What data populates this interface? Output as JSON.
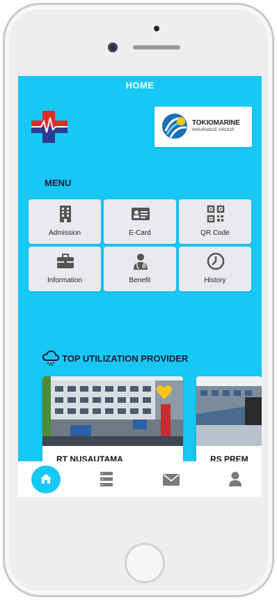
{
  "header": {
    "title": "HOME"
  },
  "partner": {
    "name": "TOKIOMARINE",
    "subtitle": "INSURANCE GROUP"
  },
  "menu": {
    "title": "MENU",
    "items": [
      {
        "label": "Admission",
        "icon": "building-icon"
      },
      {
        "label": "E-Card",
        "icon": "id-card-icon"
      },
      {
        "label": "QR Code",
        "icon": "qr-code-icon"
      },
      {
        "label": "Information",
        "icon": "briefcase-icon"
      },
      {
        "label": "Benefit",
        "icon": "doctor-icon"
      },
      {
        "label": "History",
        "icon": "clock-icon"
      }
    ]
  },
  "providers": {
    "title": "TOP UTILIZATION PROVIDER",
    "items": [
      {
        "name": "RT NUSAUTAMA",
        "favorite": true
      },
      {
        "name": "RS PREM"
      }
    ]
  },
  "bottom_nav": {
    "items": [
      {
        "icon": "home-icon",
        "active": true
      },
      {
        "icon": "list-icon",
        "active": false
      },
      {
        "icon": "mail-icon",
        "active": false
      },
      {
        "icon": "user-icon",
        "active": false
      }
    ]
  },
  "colors": {
    "accent": "#17c8f5",
    "tile": "#e9eaee",
    "heart": "#f5c518"
  }
}
